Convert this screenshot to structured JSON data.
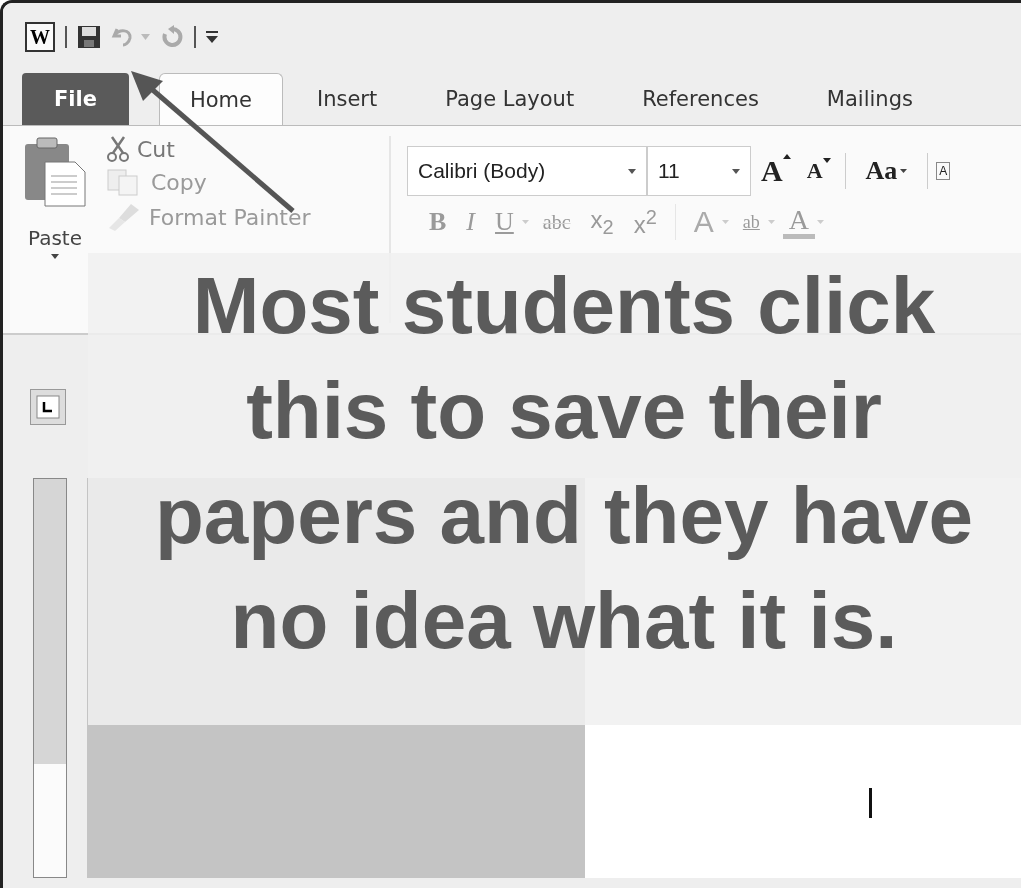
{
  "quick_access": {
    "app_letter": "W"
  },
  "tabs": [
    {
      "label": "File",
      "kind": "file",
      "selected": false
    },
    {
      "label": "Home",
      "kind": "tab",
      "selected": true
    },
    {
      "label": "Insert",
      "kind": "tab",
      "selected": false
    },
    {
      "label": "Page Layout",
      "kind": "tab",
      "selected": false
    },
    {
      "label": "References",
      "kind": "tab",
      "selected": false
    },
    {
      "label": "Mailings",
      "kind": "tab",
      "selected": false
    }
  ],
  "clipboard": {
    "paste": "Paste",
    "cut": "Cut",
    "copy": "Copy",
    "format_painter": "Format Painter"
  },
  "font": {
    "name": "Calibri (Body)",
    "size": "11",
    "tools": [
      {
        "kind": "grow",
        "label": "A"
      },
      {
        "kind": "shrink",
        "label": "A"
      },
      {
        "kind": "case",
        "label": "Aa"
      },
      {
        "kind": "clear",
        "label": "A"
      }
    ],
    "format": [
      {
        "kind": "bold",
        "label": "B"
      },
      {
        "kind": "italic",
        "label": "I"
      },
      {
        "kind": "underline",
        "label": "U"
      },
      {
        "kind": "strike",
        "label": "abc"
      },
      {
        "kind": "script",
        "label": "x$_{2}$"
      },
      {
        "kind": "script",
        "label": "x$^{2}$"
      },
      {
        "kind": "effects",
        "label": "A"
      },
      {
        "kind": "highlight",
        "label": "ab"
      },
      {
        "kind": "color",
        "label": "A"
      }
    ]
  },
  "annotation": "Most students click this to save their papers and they have no idea what it is."
}
